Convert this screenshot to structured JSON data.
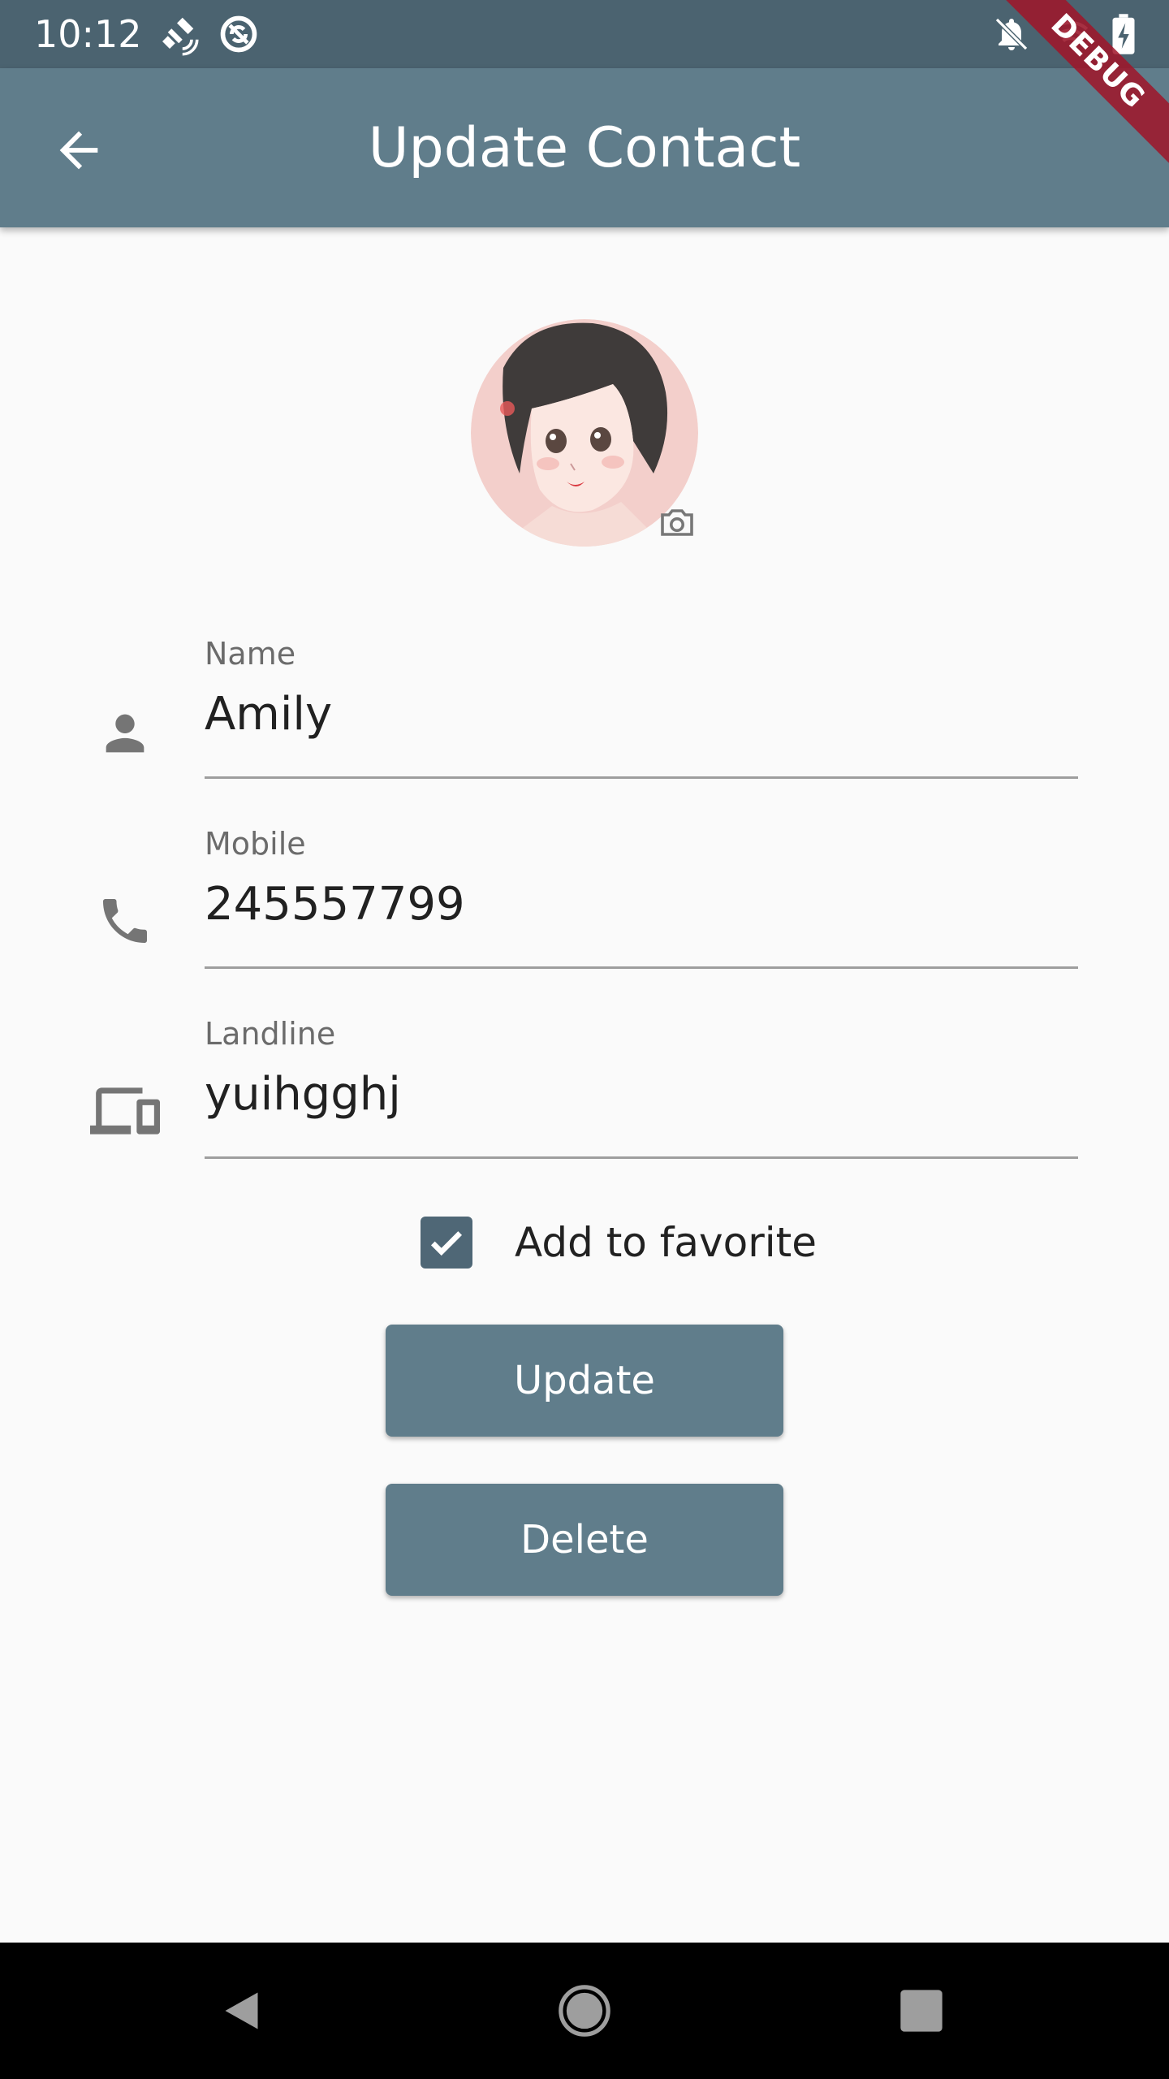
{
  "status_bar": {
    "time": "10:12",
    "icons": [
      "fake-gps-icon",
      "sync-icon",
      "notifications-off-icon",
      "wifi-icon",
      "battery-charging-icon"
    ]
  },
  "app_bar": {
    "title": "Update Contact",
    "back_icon": "arrow-back-icon"
  },
  "debug_banner": "DEBUG",
  "avatar": {
    "camera_icon": "camera-icon"
  },
  "form": {
    "name": {
      "label": "Name",
      "value": "Amily",
      "icon": "person-icon"
    },
    "mobile": {
      "label": "Mobile",
      "value": "245557799",
      "icon": "phone-icon"
    },
    "landline": {
      "label": "Landline",
      "value": "yuihgghj",
      "icon": "devices-icon"
    }
  },
  "favorite": {
    "label": "Add to favorite",
    "checked": true
  },
  "buttons": {
    "update": "Update",
    "delete": "Delete"
  },
  "nav_bar": {
    "icons": [
      "back-triangle-icon",
      "home-circle-icon",
      "recents-square-icon"
    ]
  },
  "colors": {
    "status_bar": "#4b6370",
    "app_bar": "#607d8b",
    "accent": "#607d8b",
    "checkbox": "#4f6776",
    "background": "#fafafa"
  }
}
